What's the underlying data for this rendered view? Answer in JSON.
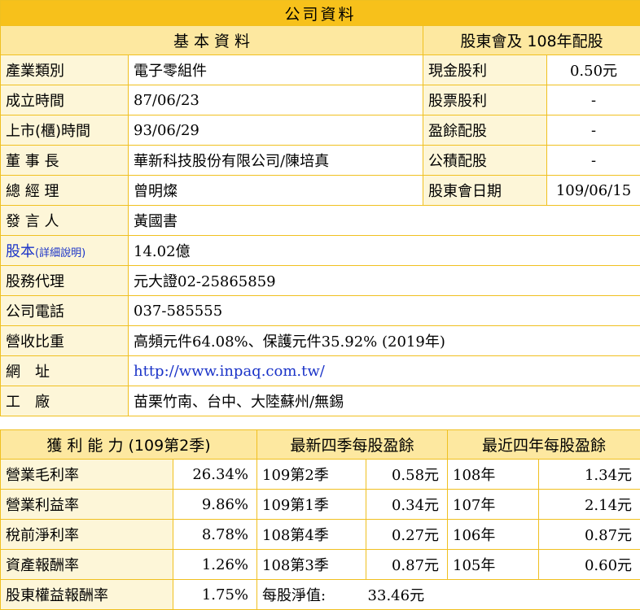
{
  "title": "公司資料",
  "basic": {
    "header": "基 本 資 料",
    "rows": [
      {
        "label": "產業類別",
        "value": "電子零組件"
      },
      {
        "label": "成立時間",
        "value": "87/06/23"
      },
      {
        "label": "上市(櫃)時間",
        "value": "93/06/29"
      },
      {
        "label": "董 事 長",
        "value": "華新科技股份有限公司/陳培真"
      },
      {
        "label": "總 經 理",
        "value": "曾明燦"
      },
      {
        "label": "發 言 人",
        "value": "黃國書"
      },
      {
        "label": "股本",
        "label_note": "(詳細說明)",
        "value": "14.02億"
      },
      {
        "label": "股務代理",
        "value": "元大證02-25865859"
      },
      {
        "label": "公司電話",
        "value": "037-585555"
      },
      {
        "label": "營收比重",
        "value": "高頻元件64.08%、保護元件35.92% (2019年)"
      },
      {
        "label": "網　址",
        "value": "http://www.inpaq.com.tw/"
      },
      {
        "label": "工　廠",
        "value": "苗栗竹南、台中、大陸蘇州/無錫"
      }
    ]
  },
  "dividend": {
    "header": "股東會及 108年配股",
    "rows": [
      {
        "label": "現金股利",
        "value": "0.50元"
      },
      {
        "label": "股票股利",
        "value": "-"
      },
      {
        "label": "盈餘配股",
        "value": "-"
      },
      {
        "label": "公積配股",
        "value": "-"
      },
      {
        "label": "股東會日期",
        "value": "109/06/15"
      }
    ]
  },
  "profit": {
    "header": "獲 利 能 力 (109第2季)",
    "rows": [
      {
        "label": "營業毛利率",
        "value": "26.34%"
      },
      {
        "label": "營業利益率",
        "value": "9.86%"
      },
      {
        "label": "稅前淨利率",
        "value": "8.78%"
      },
      {
        "label": "資產報酬率",
        "value": "1.26%"
      },
      {
        "label": "股東權益報酬率",
        "value": "1.75%"
      }
    ]
  },
  "eps_quarters": {
    "header": "最新四季每股盈餘",
    "rows": [
      {
        "label": "109第2季",
        "value": "0.58元"
      },
      {
        "label": "109第1季",
        "value": "0.34元"
      },
      {
        "label": "108第4季",
        "value": "0.27元"
      },
      {
        "label": "108第3季",
        "value": "0.87元"
      }
    ],
    "bvps_label": "每股淨值:",
    "bvps_value": "33.46元"
  },
  "eps_years": {
    "header": "最近四年每股盈餘",
    "rows": [
      {
        "label": "108年",
        "value": "1.34元"
      },
      {
        "label": "107年",
        "value": "2.14元"
      },
      {
        "label": "106年",
        "value": "0.87元"
      },
      {
        "label": "105年",
        "value": "0.60元"
      }
    ]
  },
  "colors": {
    "banner": "#f7c11b",
    "header": "#fde8a0",
    "label": "#fdf6d8",
    "border": "#f0c020",
    "link": "#1a33c8"
  }
}
